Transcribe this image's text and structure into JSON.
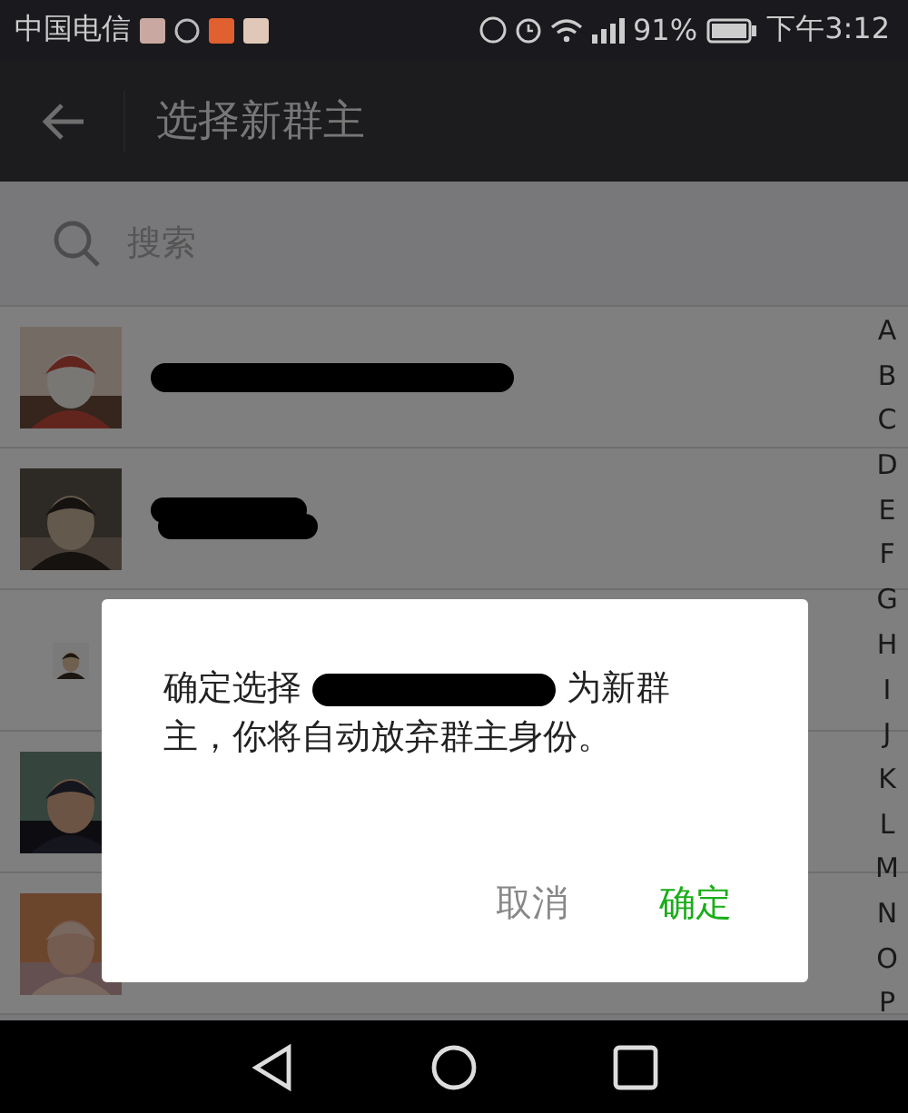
{
  "status_bar": {
    "carrier": "中国电信",
    "battery": "91%",
    "time": "下午3:12"
  },
  "header": {
    "title": "选择新群主"
  },
  "search": {
    "placeholder": "搜索"
  },
  "contacts": [
    {
      "redacted": true
    },
    {
      "redacted": true
    },
    {
      "redacted": false
    },
    {
      "redacted": false
    },
    {
      "redacted": false
    }
  ],
  "index_letters": [
    "A",
    "B",
    "C",
    "D",
    "E",
    "F",
    "G",
    "H",
    "I",
    "J",
    "K",
    "L",
    "M",
    "N",
    "O",
    "P"
  ],
  "dialog": {
    "line_1_before": "确定选择",
    "name_redacted": true,
    "line_1_after": "为新群",
    "line_2": "主，你将自动放弃群主身份。",
    "buttons": [
      {
        "label": "取消",
        "kind": "secondary"
      },
      {
        "label": "确定",
        "kind": "primary"
      }
    ]
  }
}
